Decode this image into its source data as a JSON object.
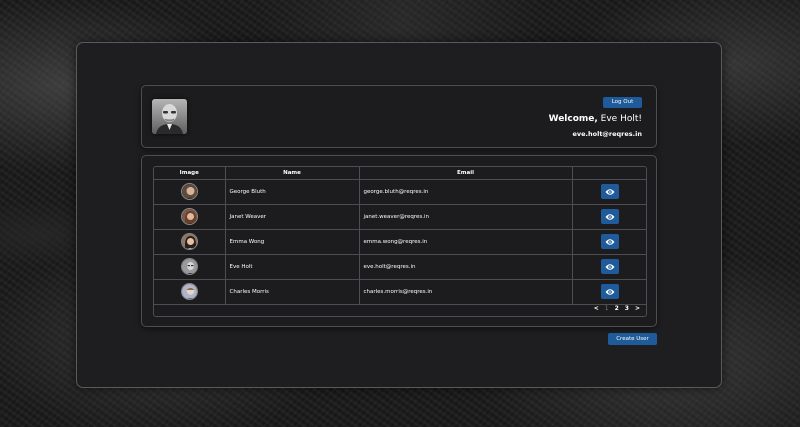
{
  "header": {
    "logout_label": "Log Out",
    "welcome_prefix": "Welcome,",
    "welcome_name": " Eve Holt!",
    "email": "eve.holt@reqres.in"
  },
  "table": {
    "columns": [
      "Image",
      "Name",
      "Email",
      ""
    ],
    "rows": [
      {
        "name": "George Bluth",
        "email": "george.bluth@reqres.in"
      },
      {
        "name": "Janet Weaver",
        "email": "janet.weaver@reqres.in"
      },
      {
        "name": "Emma Wong",
        "email": "emma.wong@reqres.in"
      },
      {
        "name": "Eve Holt",
        "email": "eve.holt@reqres.in"
      },
      {
        "name": "Charles Morris",
        "email": "charles.morris@reqres.in"
      }
    ]
  },
  "pagination": {
    "prev": "<",
    "pages": [
      "1",
      "2",
      "3"
    ],
    "next": ">"
  },
  "create_label": "Create User",
  "colors": {
    "accent": "#1f5a9a",
    "panel": "#1e1e20",
    "border": "#4e4e52"
  },
  "icons": {
    "view": "eye-icon"
  }
}
